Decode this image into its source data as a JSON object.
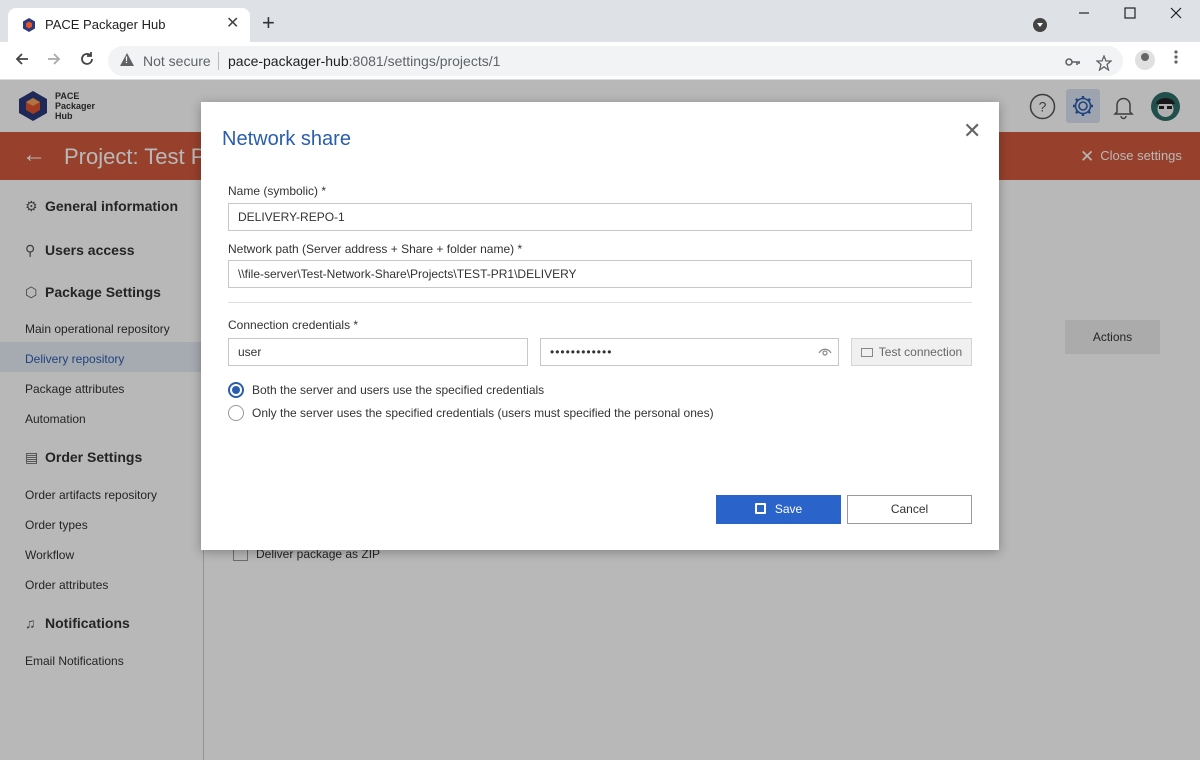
{
  "browser": {
    "tab_title": "PACE Packager Hub",
    "new_tab_symbol": "+",
    "tab_close_symbol": "✕",
    "security_label": "Not secure",
    "url_host": "pace-packager-hub",
    "url_rest": ":8081/settings/projects/1"
  },
  "app": {
    "logo_text": "PACE Packager Hub",
    "colors": {
      "accent": "#2a5db0",
      "project_bar": "#d15b3f",
      "primary_button": "#2a63c9"
    }
  },
  "project_bar": {
    "back_symbol": "←",
    "title": "Project: Test Pr",
    "close_settings": "Close settings"
  },
  "sidebar": {
    "general_information": "General information",
    "users_access": "Users access",
    "package_settings": "Package Settings",
    "main_operational_repository": "Main operational repository",
    "delivery_repository": "Delivery repository",
    "package_attributes": "Package attributes",
    "automation": "Automation",
    "order_settings": "Order Settings",
    "order_artifacts_repository": "Order artifacts repository",
    "order_types": "Order types",
    "workflow": "Workflow",
    "order_attributes": "Order attributes",
    "notifications": "Notifications",
    "email_notifications": "Email Notifications"
  },
  "content": {
    "actions_header": "Actions",
    "deliver_zip": "Deliver package as ZIP"
  },
  "modal": {
    "title": "Network share",
    "close_symbol": "✕",
    "name_label": "Name (symbolic) *",
    "name_value": "DELIVERY-REPO-1",
    "path_label": "Network path (Server address + Share + folder name) *",
    "path_value": "\\\\file-server\\Test-Network-Share\\Projects\\TEST-PR1\\DELIVERY",
    "credentials_label": "Connection credentials *",
    "username_value": "user",
    "password_masked": "••••••••••••",
    "test_connection": "Test connection",
    "radio_both": "Both the server and users use the specified credentials",
    "radio_server_only": "Only the server uses the specified credentials (users must specified the personal ones)",
    "selected_option": "both",
    "save": "Save",
    "cancel": "Cancel"
  }
}
